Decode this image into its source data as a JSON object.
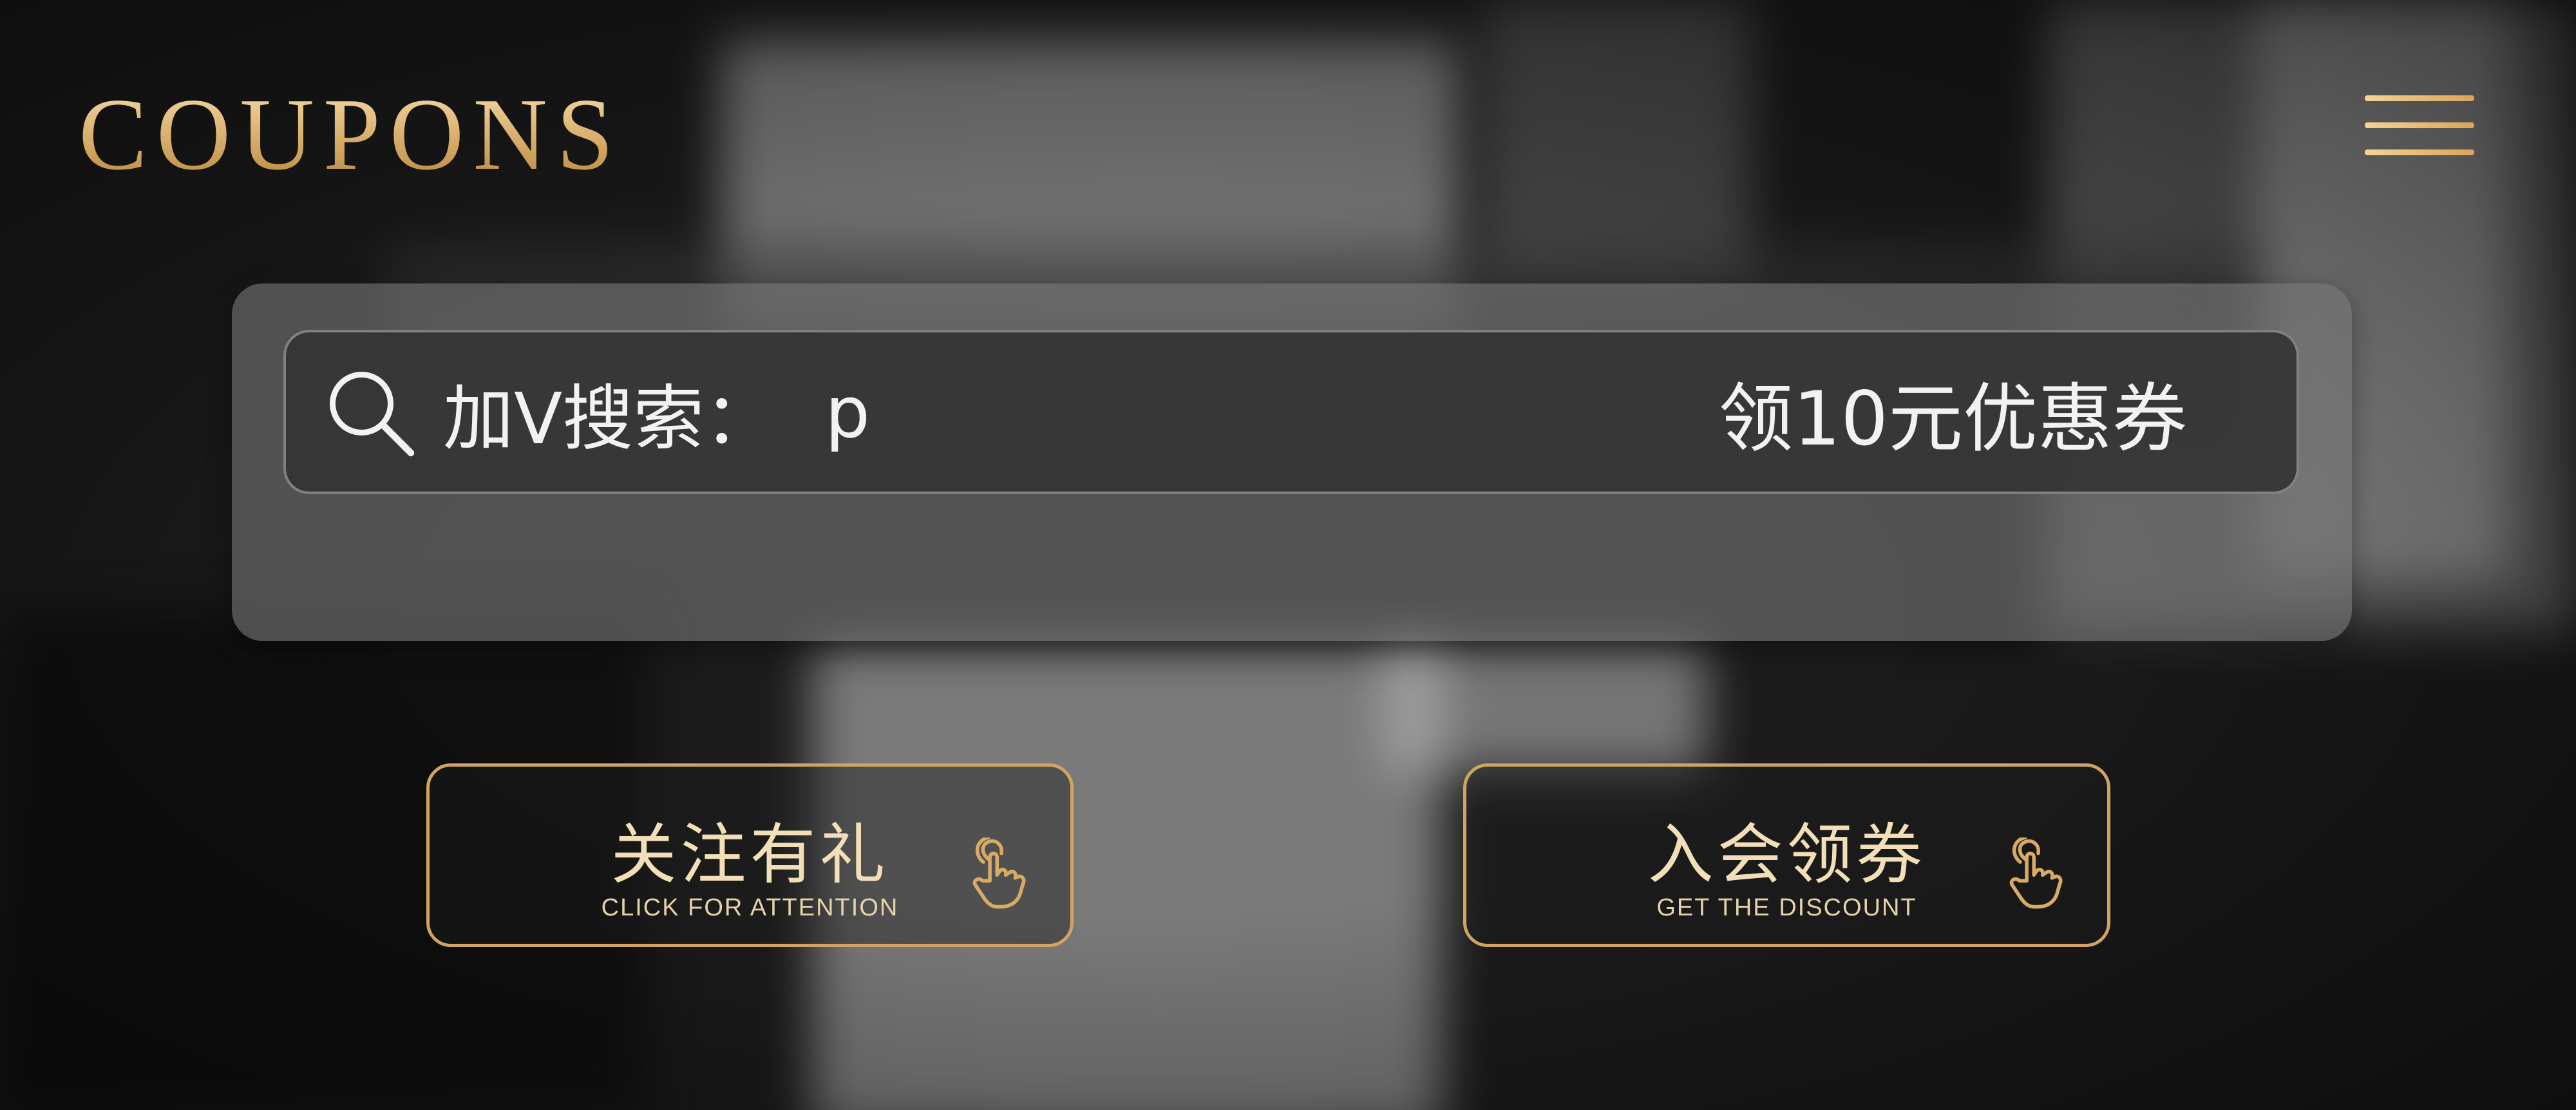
{
  "header": {
    "brand": "COUPONS"
  },
  "search": {
    "label": "加V搜索：",
    "value": "p",
    "promo": "领10元优惠券",
    "icon": "search-icon"
  },
  "actions": [
    {
      "title": "关注有礼",
      "subtitle": "CLICK FOR ATTENTION",
      "icon": "hand-pointer-icon"
    },
    {
      "title": "入会领券",
      "subtitle": "GET THE DISCOUNT",
      "icon": "hand-pointer-icon"
    }
  ],
  "colors": {
    "accent_gold": "#d1a560",
    "panel": "#767676",
    "text": "#f2f2f2"
  }
}
